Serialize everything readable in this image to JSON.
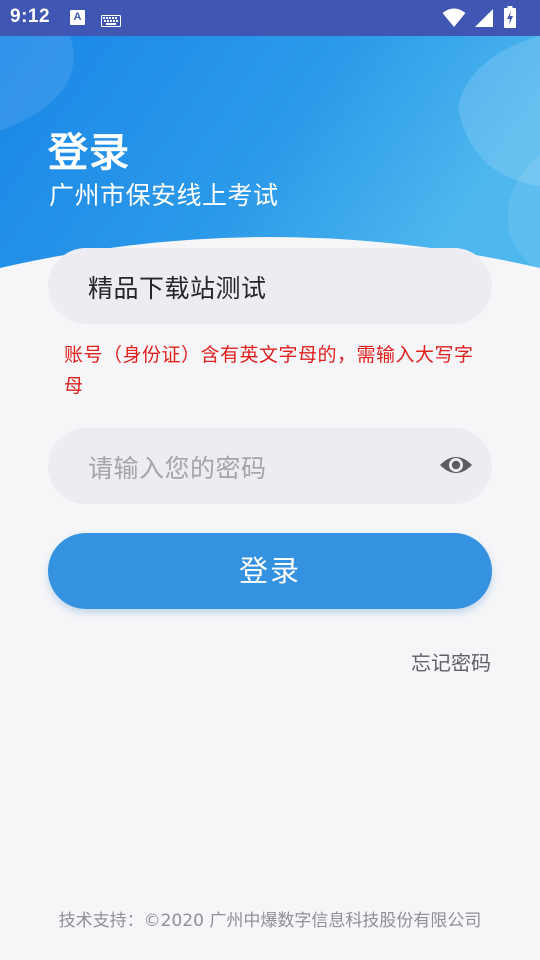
{
  "status_bar": {
    "time": "9:12",
    "notification_icons": [
      "a-icon",
      "keyboard-icon"
    ],
    "system_icons": [
      "wifi-icon",
      "signal-icon",
      "battery-icon"
    ],
    "a_label": "A"
  },
  "header": {
    "title": "登录",
    "subtitle": "广州市保安线上考试"
  },
  "form": {
    "account_value": "精品下载站测试",
    "account_hint": "账号（身份证）含有英文字母的，需输入大写字母",
    "password_placeholder": "请输入您的密码",
    "password_toggle_icon": "eye-icon",
    "login_label": "登录",
    "forgot_label": "忘记密码"
  },
  "footer": {
    "text": "技术支持：©2020 广州中爆数字信息科技股份有限公司"
  },
  "colors": {
    "status_bar": "#3f56b3",
    "header_blue": "#1e88e5",
    "button_blue": "#3592e0",
    "hint_red": "#e0201e",
    "field_bg": "#ececf2",
    "page_bg": "#f6f6f8"
  }
}
